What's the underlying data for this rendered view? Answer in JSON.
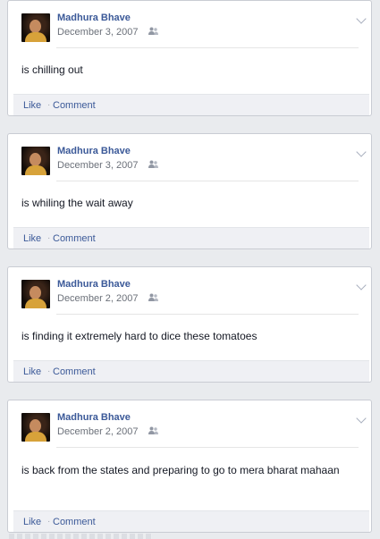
{
  "posts": [
    {
      "author": "Madhura Bhave",
      "date": "December 3, 2007",
      "status": "is chilling out",
      "like_label": "Like",
      "separator": "·",
      "comment_label": "Comment"
    },
    {
      "author": "Madhura Bhave",
      "date": "December 3, 2007",
      "status": "is whiling the wait away",
      "like_label": "Like",
      "separator": "·",
      "comment_label": "Comment"
    },
    {
      "author": "Madhura Bhave",
      "date": "December 2, 2007",
      "status": "is finding it extremely hard to dice these tomatoes",
      "like_label": "Like",
      "separator": "·",
      "comment_label": "Comment"
    },
    {
      "author": "Madhura Bhave",
      "date": "December 2, 2007",
      "status": "is back from the states and preparing to go to mera bharat mahaan",
      "like_label": "Like",
      "separator": "·",
      "comment_label": "Comment"
    }
  ],
  "icons": {
    "audience": "friends-icon",
    "menu": "chevron-down-icon"
  },
  "colors": {
    "link": "#3b5998",
    "background": "#e9ebee",
    "card": "#ffffff",
    "action_bar": "#eff0f4",
    "meta_text": "#6b7079"
  }
}
